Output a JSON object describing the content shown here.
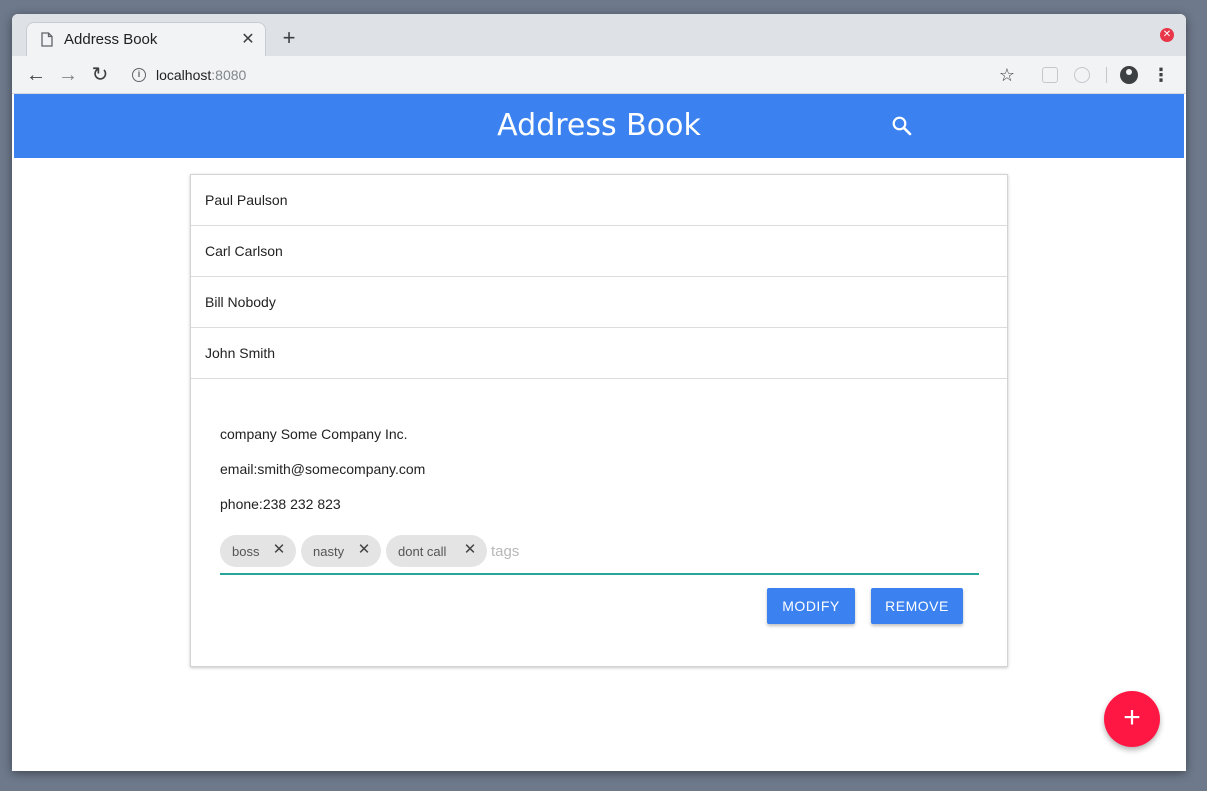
{
  "browser": {
    "tab_title": "Address Book",
    "new_tab_icon": "+",
    "url_host": "localhost",
    "url_port": ":8080"
  },
  "app": {
    "title": "Address Book",
    "accent_color": "#3b82f0",
    "fab_color": "#ff1744",
    "fab_label": "+"
  },
  "contacts": [
    {
      "name": "Paul Paulson"
    },
    {
      "name": "Carl Carlson"
    },
    {
      "name": "Bill Nobody"
    },
    {
      "name": "John Smith"
    }
  ],
  "selected_contact": {
    "company": "company Some Company Inc.",
    "email": "email:smith@somecompany.com",
    "phone": "phone:238 232 823",
    "tags": [
      "boss",
      "nasty",
      "dont call"
    ],
    "tags_placeholder": "tags"
  },
  "actions": {
    "modify": "MODIFY",
    "remove": "REMOVE"
  }
}
